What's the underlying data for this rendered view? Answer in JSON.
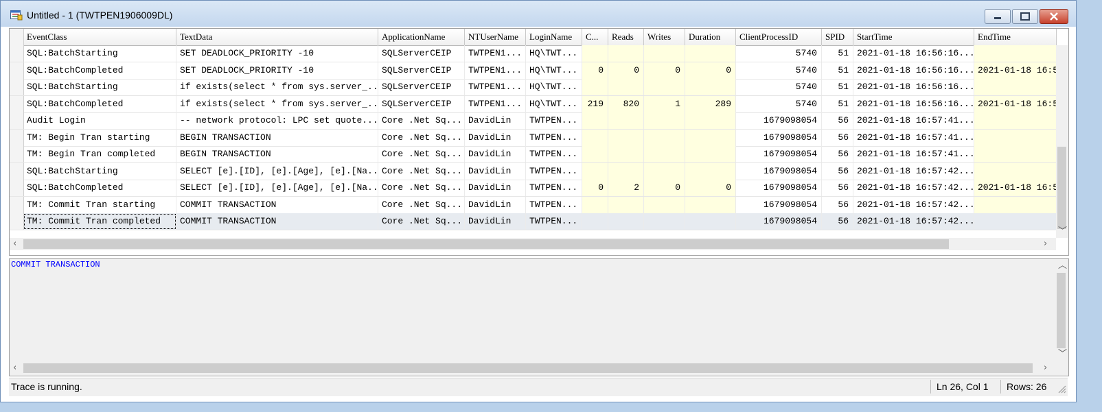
{
  "window": {
    "title": "Untitled - 1 (TWTPEN1906009DL)",
    "icon": "trace-window-icon",
    "controls": [
      "minimize-icon",
      "maximize-icon",
      "close-icon"
    ]
  },
  "grid": {
    "columns": [
      "EventClass",
      "TextData",
      "ApplicationName",
      "NTUserName",
      "LoginName",
      "C...",
      "Reads",
      "Writes",
      "Duration",
      "ClientProcessID",
      "SPID",
      "StartTime",
      "EndTime"
    ],
    "rows": [
      {
        "EventClass": "SQL:BatchStarting",
        "TextData": "SET DEADLOCK_PRIORITY -10",
        "ApplicationName": "SQLServerCEIP",
        "NTUserName": "TWTPEN1...",
        "LoginName": "HQ\\TWT...",
        "CPU": "",
        "Reads": "",
        "Writes": "",
        "Duration": "",
        "ClientProcessID": "5740",
        "SPID": "51",
        "StartTime": "2021-01-18 16:56:16...",
        "EndTime": ""
      },
      {
        "EventClass": "SQL:BatchCompleted",
        "TextData": "SET DEADLOCK_PRIORITY -10",
        "ApplicationName": "SQLServerCEIP",
        "NTUserName": "TWTPEN1...",
        "LoginName": "HQ\\TWT...",
        "CPU": "0",
        "Reads": "0",
        "Writes": "0",
        "Duration": "0",
        "ClientProcessID": "5740",
        "SPID": "51",
        "StartTime": "2021-01-18 16:56:16...",
        "EndTime": "2021-01-18 16:5"
      },
      {
        "EventClass": "SQL:BatchStarting",
        "TextData": "if exists(select * from sys.server_...",
        "ApplicationName": "SQLServerCEIP",
        "NTUserName": "TWTPEN1...",
        "LoginName": "HQ\\TWT...",
        "CPU": "",
        "Reads": "",
        "Writes": "",
        "Duration": "",
        "ClientProcessID": "5740",
        "SPID": "51",
        "StartTime": "2021-01-18 16:56:16...",
        "EndTime": ""
      },
      {
        "EventClass": "SQL:BatchCompleted",
        "TextData": "if exists(select * from sys.server_...",
        "ApplicationName": "SQLServerCEIP",
        "NTUserName": "TWTPEN1...",
        "LoginName": "HQ\\TWT...",
        "CPU": "219",
        "Reads": "820",
        "Writes": "1",
        "Duration": "289",
        "ClientProcessID": "5740",
        "SPID": "51",
        "StartTime": "2021-01-18 16:56:16...",
        "EndTime": "2021-01-18 16:5"
      },
      {
        "EventClass": "Audit Login",
        "TextData": "-- network protocol: LPC  set quote...",
        "ApplicationName": "Core .Net Sq...",
        "NTUserName": "DavidLin",
        "LoginName": "TWTPEN...",
        "CPU": "",
        "Reads": "",
        "Writes": "",
        "Duration": "",
        "ClientProcessID": "1679098054",
        "SPID": "56",
        "StartTime": "2021-01-18 16:57:41...",
        "EndTime": ""
      },
      {
        "EventClass": "TM: Begin Tran starting",
        "TextData": "BEGIN TRANSACTION",
        "ApplicationName": "Core .Net Sq...",
        "NTUserName": "DavidLin",
        "LoginName": "TWTPEN...",
        "CPU": "",
        "Reads": "",
        "Writes": "",
        "Duration": "",
        "ClientProcessID": "1679098054",
        "SPID": "56",
        "StartTime": "2021-01-18 16:57:41...",
        "EndTime": ""
      },
      {
        "EventClass": "TM: Begin Tran completed",
        "TextData": "BEGIN TRANSACTION",
        "ApplicationName": "Core .Net Sq...",
        "NTUserName": "DavidLin",
        "LoginName": "TWTPEN...",
        "CPU": "",
        "Reads": "",
        "Writes": "",
        "Duration": "",
        "ClientProcessID": "1679098054",
        "SPID": "56",
        "StartTime": "2021-01-18 16:57:41...",
        "EndTime": ""
      },
      {
        "EventClass": "SQL:BatchStarting",
        "TextData": "SELECT [e].[ID], [e].[Age], [e].[Na...",
        "ApplicationName": "Core .Net Sq...",
        "NTUserName": "DavidLin",
        "LoginName": "TWTPEN...",
        "CPU": "",
        "Reads": "",
        "Writes": "",
        "Duration": "",
        "ClientProcessID": "1679098054",
        "SPID": "56",
        "StartTime": "2021-01-18 16:57:42...",
        "EndTime": ""
      },
      {
        "EventClass": "SQL:BatchCompleted",
        "TextData": "SELECT [e].[ID], [e].[Age], [e].[Na...",
        "ApplicationName": "Core .Net Sq...",
        "NTUserName": "DavidLin",
        "LoginName": "TWTPEN...",
        "CPU": "0",
        "Reads": "2",
        "Writes": "0",
        "Duration": "0",
        "ClientProcessID": "1679098054",
        "SPID": "56",
        "StartTime": "2021-01-18 16:57:42...",
        "EndTime": "2021-01-18 16:5"
      },
      {
        "EventClass": "TM: Commit Tran starting",
        "TextData": "COMMIT TRANSACTION",
        "ApplicationName": "Core .Net Sq...",
        "NTUserName": "DavidLin",
        "LoginName": "TWTPEN...",
        "CPU": "",
        "Reads": "",
        "Writes": "",
        "Duration": "",
        "ClientProcessID": "1679098054",
        "SPID": "56",
        "StartTime": "2021-01-18 16:57:42...",
        "EndTime": ""
      },
      {
        "EventClass": "TM: Commit Tran completed",
        "TextData": "COMMIT TRANSACTION",
        "ApplicationName": "Core .Net Sq...",
        "NTUserName": "DavidLin",
        "LoginName": "TWTPEN...",
        "CPU": "",
        "Reads": "",
        "Writes": "",
        "Duration": "",
        "ClientProcessID": "1679098054",
        "SPID": "56",
        "StartTime": "2021-01-18 16:57:42...",
        "EndTime": ""
      }
    ],
    "selected_row": 10
  },
  "detail": {
    "text": "COMMIT TRANSACTION"
  },
  "status": {
    "message": "Trace is running.",
    "position": "Ln 26, Col 1",
    "rows": "Rows: 26"
  },
  "colors": {
    "detail_text": "#0000ff",
    "numeric_cell_bg": "#ffffe0",
    "selected_row_bg": "#e7ebf0"
  }
}
